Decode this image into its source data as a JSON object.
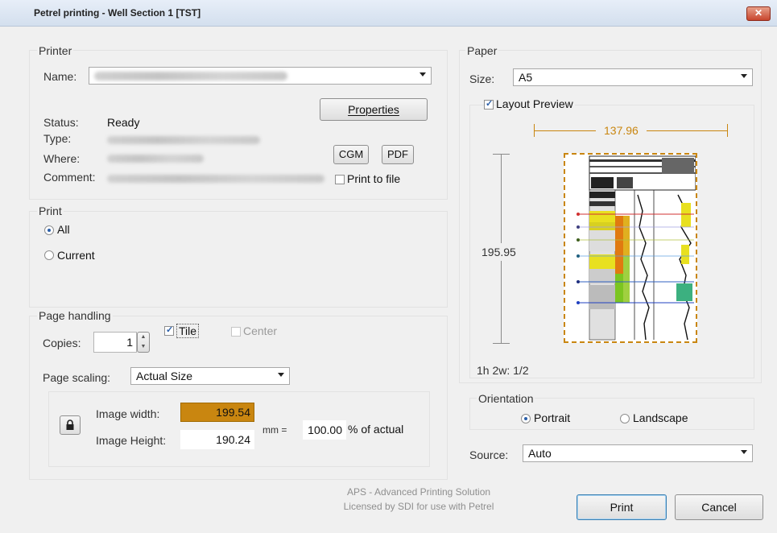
{
  "window": {
    "title": "Petrel printing - Well Section 1 [TST]",
    "close_label": "✕"
  },
  "printer": {
    "group_label": "Printer",
    "name_label": "Name:",
    "properties_label": "Properties",
    "status_label": "Status:",
    "status_value": "Ready",
    "type_label": "Type:",
    "where_label": "Where:",
    "comment_label": "Comment:",
    "cgm_label": "CGM",
    "pdf_label": "PDF",
    "print_to_file_label": "Print to file"
  },
  "print": {
    "group_label": "Print",
    "all_label": "All",
    "current_label": "Current",
    "selected": "All"
  },
  "page_handling": {
    "group_label": "Page handling",
    "copies_label": "Copies:",
    "copies_value": "1",
    "tile_label": "Tile",
    "tile_checked": true,
    "center_label": "Center",
    "center_checked": false,
    "scaling_label": "Page scaling:",
    "scaling_value": "Actual Size",
    "image_width_label": "Image width:",
    "image_width_value": "199.54",
    "image_height_label": "Image Height:",
    "image_height_value": "190.24",
    "mm_label": "mm =",
    "percent_value": "100.00",
    "percent_label": "% of actual"
  },
  "paper": {
    "group_label": "Paper",
    "size_label": "Size:",
    "size_value": "A5",
    "layout_preview_label": "Layout Preview",
    "layout_preview_checked": true,
    "width_value": "137.96",
    "height_value": "195.95",
    "page_info": "1h 2w: 1/2"
  },
  "orientation": {
    "group_label": "Orientation",
    "portrait_label": "Portrait",
    "landscape_label": "Landscape",
    "selected": "Portrait"
  },
  "source": {
    "label": "Source:",
    "value": "Auto"
  },
  "footer": {
    "line1": "APS - Advanced Printing Solution",
    "line2": "Licensed by SDI for use with Petrel",
    "print_label": "Print",
    "cancel_label": "Cancel"
  },
  "colors": {
    "accent": "#2a5ea8",
    "highlight": "#c98610",
    "dashed_border": "#c98610"
  }
}
